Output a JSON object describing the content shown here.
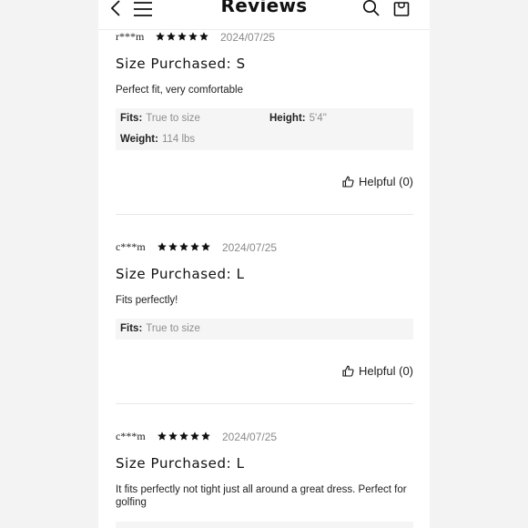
{
  "header": {
    "title": "Reviews",
    "back_icon": "chevron-left-icon",
    "menu_icon": "hamburger-menu-icon",
    "search_icon": "search-icon",
    "bag_icon": "shopping-bag-icon"
  },
  "colors": {
    "star": "#111111",
    "muted": "#8e8e8e",
    "spec_bg": "#f5f5f5"
  },
  "reviews": [
    {
      "user": "r***m",
      "rating": 5,
      "date": "2024/07/25",
      "size": "Size Purchased: S",
      "text": "Perfect fit, very comfortable",
      "fits_label": "Fits:",
      "fits_value": "True to size",
      "height_label": "Height:",
      "height_value": "5'4''",
      "weight_label": "Weight:",
      "weight_value": "114 lbs",
      "helpful": "Helpful (0)"
    },
    {
      "user": "c***m",
      "rating": 5,
      "date": "2024/07/25",
      "size": "Size Purchased: L",
      "text": "Fits perfectly!",
      "fits_label": "Fits:",
      "fits_value": "True to size",
      "helpful": "Helpful (0)"
    },
    {
      "user": "c***m",
      "rating": 5,
      "date": "2024/07/25",
      "size": "Size Purchased: L",
      "text": "It fits perfectly not tight just all around a great dress. Perfect for golfing"
    }
  ]
}
